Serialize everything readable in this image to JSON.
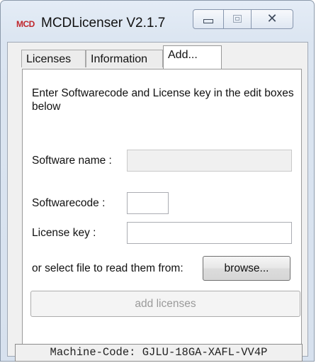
{
  "window": {
    "title": "MCDLicenser V2.1.7",
    "app_icon_text": "MCD",
    "app_icon_color": "#c0272d",
    "controls": {
      "minimize": "minimize-icon",
      "maximize": "maximize-icon",
      "close_glyph": "✕"
    }
  },
  "tabs": [
    {
      "label": "Licenses",
      "active": false
    },
    {
      "label": "Information",
      "active": false
    },
    {
      "label": "Add...",
      "active": true
    }
  ],
  "add_tab": {
    "instruction": "Enter Softwarecode and License key in the edit boxes below",
    "software_name_label": "Software name :",
    "software_name_value": "",
    "softwarecode_label": "Softwarecode :",
    "softwarecode_value": "",
    "license_key_label": "License key :",
    "license_key_value": "",
    "file_prompt": "or select file to read them from:",
    "browse_label": "browse...",
    "add_licenses_label": "add licenses"
  },
  "status": {
    "machine_code": "Machine-Code: GJLU-18GA-XAFL-VV4P"
  }
}
